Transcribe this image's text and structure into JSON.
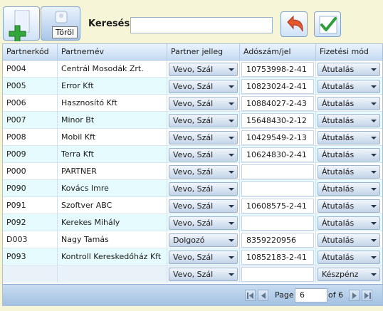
{
  "toolbar": {
    "add_icon": "add-person-icon",
    "delete_icon": "delete-person-icon",
    "tooltip": "Töröl",
    "search_label": "Keresés:",
    "search_value": "",
    "undo_icon": "undo-arrow-icon",
    "ok_icon": "checkmark-icon"
  },
  "grid": {
    "columns": [
      "Partnerkód",
      "Partnernév",
      "Partner jelleg",
      "Adószám/jel",
      "Fizetési mód"
    ],
    "rows": [
      {
        "code": "P004",
        "name": "Centrál Mosodák Zrt.",
        "type": "Vevo, Szál",
        "tax": "10753998-2-41",
        "payment": "Átutalás"
      },
      {
        "code": "P005",
        "name": "Error Kft",
        "type": "Vevo, Szál",
        "tax": "10823024-2-41",
        "payment": "Átutalás"
      },
      {
        "code": "P006",
        "name": "Hasznosító Kft",
        "type": "Vevo, Szál",
        "tax": "10884027-2-43",
        "payment": "Átutalás"
      },
      {
        "code": "P007",
        "name": "Minor Bt",
        "type": "Vevo, Szál",
        "tax": "15648430-2-12",
        "payment": "Átutalás"
      },
      {
        "code": "P008",
        "name": "Mobil Kft",
        "type": "Vevo, Szál",
        "tax": "10429549-2-13",
        "payment": "Átutalás"
      },
      {
        "code": "P009",
        "name": "Terra Kft",
        "type": "Vevo, Szál",
        "tax": "10624830-2-41",
        "payment": "Átutalás"
      },
      {
        "code": "P000",
        "name": "PARTNER",
        "type": "Vevo, Szál",
        "tax": "",
        "payment": "Átutalás"
      },
      {
        "code": "P090",
        "name": "Kovács Imre",
        "type": "Vevo, Szál",
        "tax": "",
        "payment": "Átutalás"
      },
      {
        "code": "P091",
        "name": "Szoftver ABC",
        "type": "Vevo, Szál",
        "tax": "10608575-2-41",
        "payment": "Átutalás"
      },
      {
        "code": "P092",
        "name": "Kerekes Mihály",
        "type": "Vevo, Szál",
        "tax": "",
        "payment": "Átutalás"
      },
      {
        "code": "D003",
        "name": "Nagy Tamás",
        "type": "Dolgozó",
        "tax": "8359220956",
        "payment": "Átutalás"
      },
      {
        "code": "P093",
        "name": "Kontroll Kereskedőház Kft",
        "type": "Vevo, Szál",
        "tax": "10852183-2-41",
        "payment": "Átutalás"
      }
    ],
    "new_row": {
      "code": "",
      "name": "",
      "type": "Vevo, Szál",
      "tax": "",
      "payment": "Készpénz"
    }
  },
  "pager": {
    "label": "Page",
    "current": "6",
    "of_label": "of 6",
    "first_icon": "first-page-icon",
    "prev_icon": "prev-page-icon",
    "next_icon": "next-page-icon",
    "last_icon": "last-page-icon"
  }
}
